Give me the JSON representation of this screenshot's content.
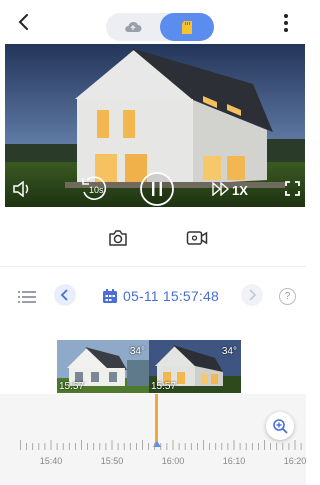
{
  "topbar": {
    "icons": {
      "back": "back-arrow-icon",
      "cloud": "cloud-icon",
      "sdcard": "sd-card-icon",
      "more": "more-vertical-icon"
    },
    "accent_color": "#5b8def"
  },
  "player": {
    "rewind_label": "10s",
    "speed_label": "1X",
    "icons": {
      "volume": "volume-icon",
      "rewind": "rewind-10s-icon",
      "pause": "pause-icon",
      "speed": "fast-forward-icon",
      "fullscreen": "fullscreen-icon"
    }
  },
  "tools": {
    "icons": {
      "snapshot": "camera-icon",
      "record": "record-video-icon"
    }
  },
  "date_nav": {
    "datetime": "05-11 15:57:48",
    "icons": {
      "list": "list-icon",
      "prev": "chevron-left-icon",
      "calendar": "calendar-icon",
      "next": "chevron-right-icon"
    },
    "help_label": "?"
  },
  "thumbnails": [
    {
      "temp": "34°",
      "time": "15:57"
    },
    {
      "temp": "34°",
      "time": "15:57"
    }
  ],
  "timeline": {
    "labels": [
      "15:40",
      "15:50",
      "16:00",
      "16:10",
      "16:20"
    ],
    "cursor_color": "#f0a93a",
    "icons": {
      "zoom": "zoom-in-icon"
    }
  }
}
